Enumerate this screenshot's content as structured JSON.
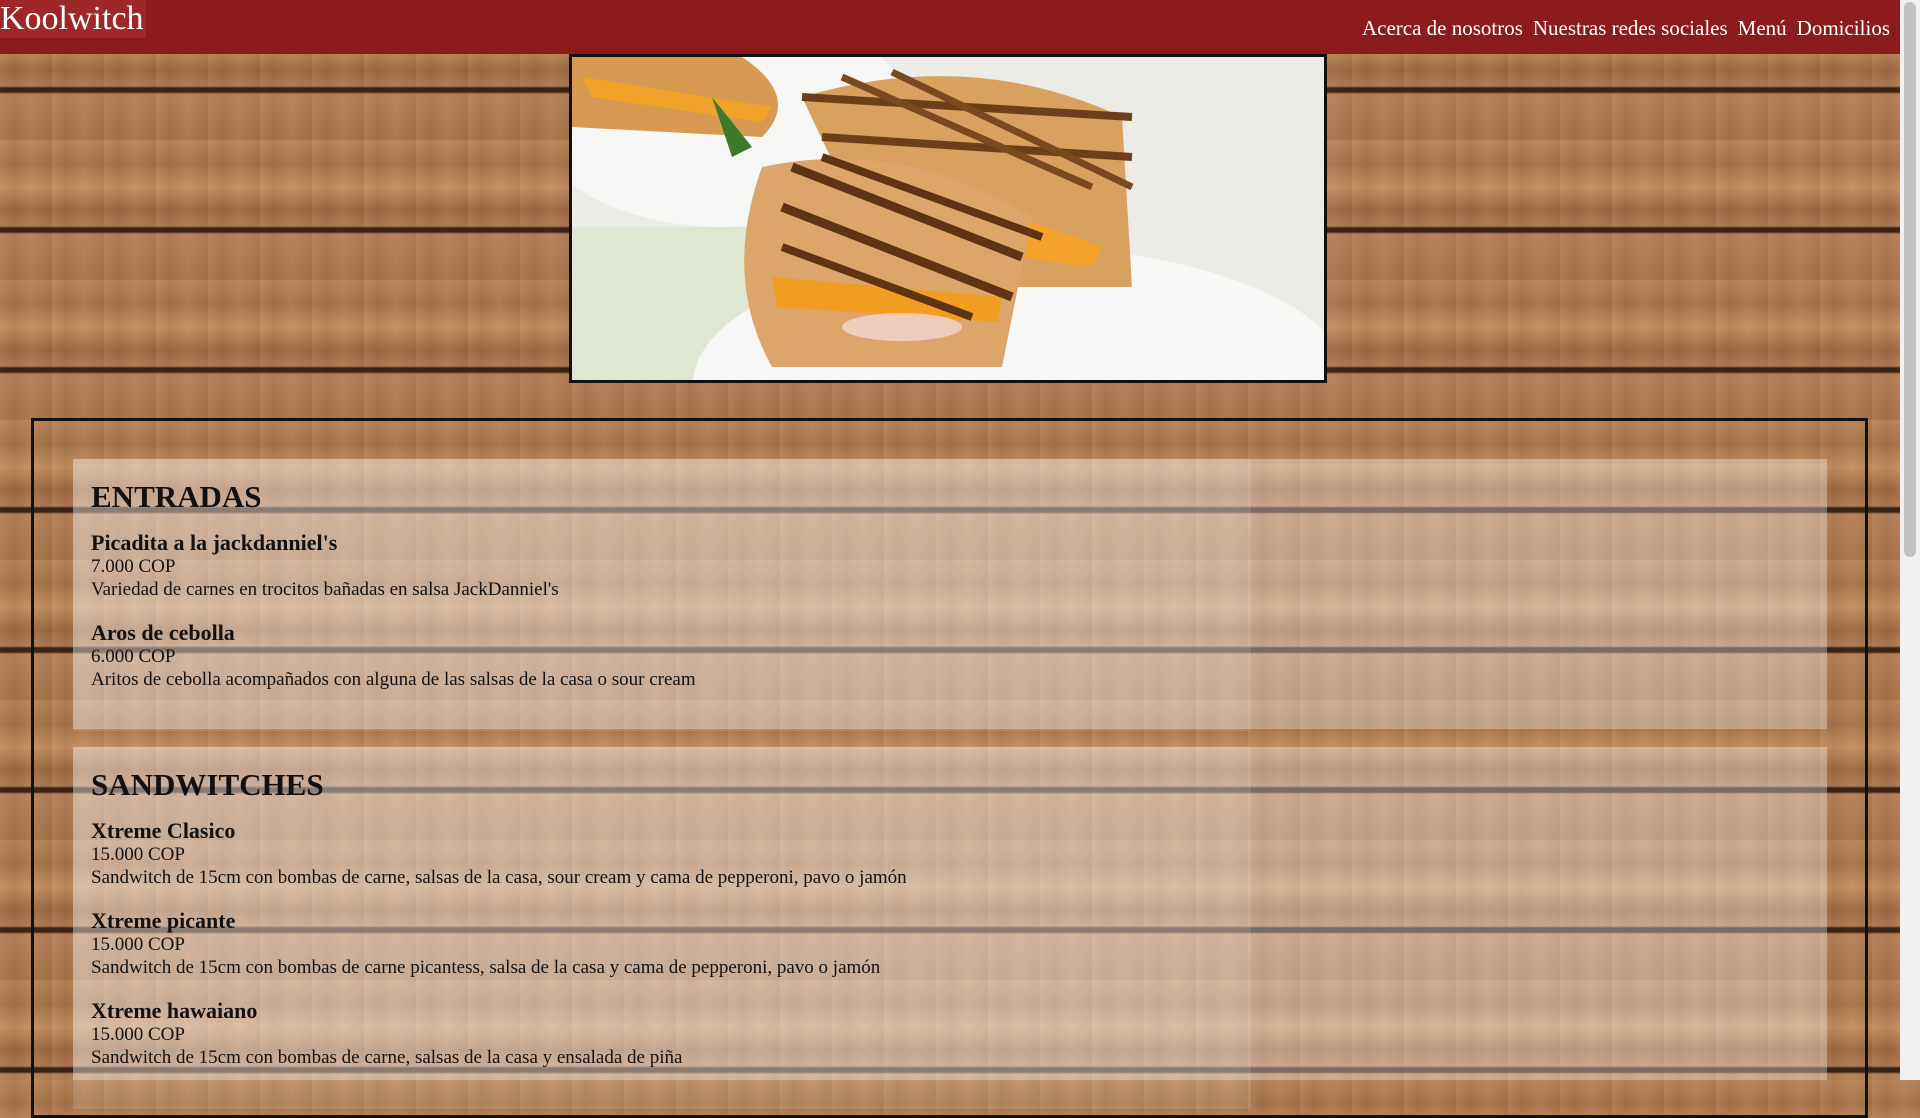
{
  "nav": {
    "brand": "Koolwitch",
    "links": [
      "Acerca de nosotros",
      "Nuestras redes sociales",
      "Menú",
      "Domicilios"
    ]
  },
  "hero": {
    "icon": "grilled-sandwich-photo"
  },
  "sections": [
    {
      "title": "ENTRADAS",
      "items": [
        {
          "name": "Picadita a la jackdanniel's",
          "price": "7.000 COP",
          "desc": "Variedad de carnes en trocitos bañadas en salsa JackDanniel's"
        },
        {
          "name": "Aros de cebolla",
          "price": "6.000 COP",
          "desc": "Aritos de cebolla acompañados con alguna de las salsas de la casa o sour cream"
        }
      ]
    },
    {
      "title": "SANDWITCHES",
      "items": [
        {
          "name": "Xtreme Clasico",
          "price": "15.000 COP",
          "desc": "Sandwitch de 15cm con bombas de carne, salsas de la casa, sour cream y cama de pepperoni, pavo o jamón"
        },
        {
          "name": "Xtreme picante",
          "price": "15.000 COP",
          "desc": "Sandwitch de 15cm con bombas de carne picantess, salsa de la casa y cama de pepperoni, pavo o jamón"
        },
        {
          "name": "Xtreme hawaiano",
          "price": "15.000 COP",
          "desc": "Sandwitch de 15cm con bombas de carne, salsas de la casa y ensalada de piña"
        }
      ]
    }
  ],
  "colors": {
    "navbar": "#8c1c1c",
    "brand_bg": "#9e2727",
    "text": "#111111"
  }
}
